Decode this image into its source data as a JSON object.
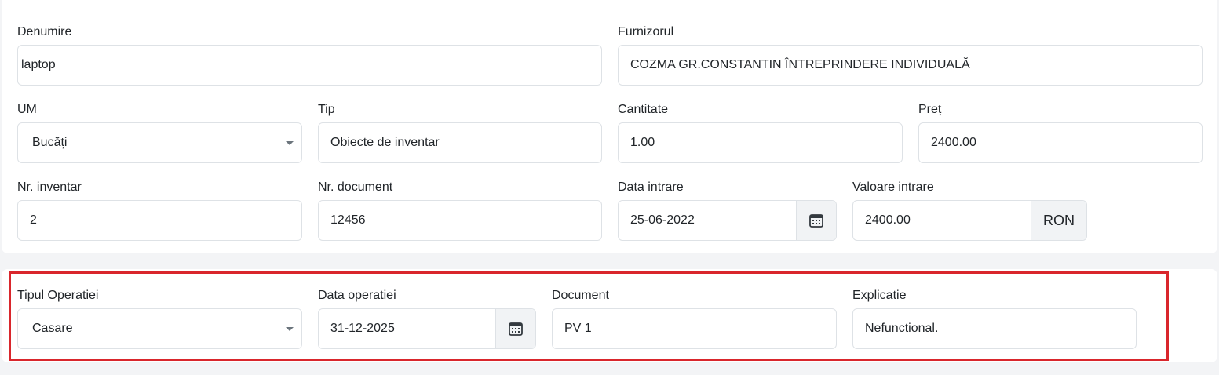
{
  "asset": {
    "denumire": {
      "label": "Denumire",
      "value": "laptop"
    },
    "furnizorul": {
      "label": "Furnizorul",
      "value": "COZMA GR.CONSTANTIN ÎNTREPRINDERE INDIVIDUALĂ"
    },
    "um": {
      "label": "UM",
      "value": "Bucăți"
    },
    "tip": {
      "label": "Tip",
      "value": "Obiecte de inventar"
    },
    "cantitate": {
      "label": "Cantitate",
      "value": "1.00"
    },
    "pret": {
      "label": "Preț",
      "value": "2400.00"
    },
    "nr_inventar": {
      "label": "Nr. inventar",
      "value": "2"
    },
    "nr_document": {
      "label": "Nr. document",
      "value": "12456"
    },
    "data_intrare": {
      "label": "Data intrare",
      "value": "25-06-2022"
    },
    "valoare_intrare": {
      "label": "Valoare intrare",
      "value": "2400.00",
      "currency": "RON"
    }
  },
  "operation": {
    "tipul_operatiei": {
      "label": "Tipul Operatiei",
      "value": "Casare"
    },
    "data_operatiei": {
      "label": "Data operatiei",
      "value": "31-12-2025"
    },
    "document": {
      "label": "Document",
      "value": "PV 1"
    },
    "explicatie": {
      "label": "Explicatie",
      "value": "Nefunctional."
    }
  },
  "icons": {
    "calendar": "calendar-icon",
    "dropdown": "chevron-down-icon"
  },
  "colors": {
    "highlight": "#d9262c",
    "border": "#dee2e6",
    "addon_bg": "#f1f3f5"
  }
}
